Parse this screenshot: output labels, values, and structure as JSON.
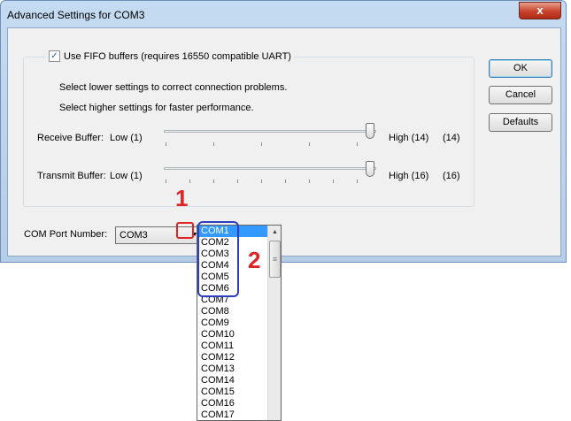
{
  "window": {
    "title": "Advanced Settings for COM3",
    "close_glyph": "x"
  },
  "fifo": {
    "checked": true,
    "check_glyph": "✓",
    "label": "Use FIFO buffers (requires 16550 compatible UART)"
  },
  "hints": {
    "lower": "Select lower settings to correct connection problems.",
    "higher": "Select higher settings for faster performance."
  },
  "receive": {
    "label": "Receive Buffer:",
    "low": "Low (1)",
    "high": "High (14)",
    "value": "(14)"
  },
  "transmit": {
    "label": "Transmit Buffer:",
    "low": "Low (1)",
    "high": "High (16)",
    "value": "(16)"
  },
  "buttons": {
    "ok": "OK",
    "cancel": "Cancel",
    "defaults": "Defaults"
  },
  "com_port": {
    "label": "COM Port Number:",
    "value": "COM3",
    "arrow_glyph": "▼"
  },
  "dropdown": {
    "items": [
      "COM1",
      "COM2",
      "COM3",
      "COM4",
      "COM5",
      "COM6",
      "COM7",
      "COM8",
      "COM9",
      "COM10",
      "COM11",
      "COM12",
      "COM13",
      "COM14",
      "COM15",
      "COM16",
      "COM17"
    ],
    "highlighted": "COM1",
    "scroll_up_glyph": "▲",
    "thumb_grip_glyph": "≡"
  },
  "annotations": {
    "step1": "1",
    "step2": "2"
  },
  "colors": {
    "annotation_red": "#e02424",
    "annotation_blue": "#2f3ebc",
    "selection": "#3399ff"
  }
}
